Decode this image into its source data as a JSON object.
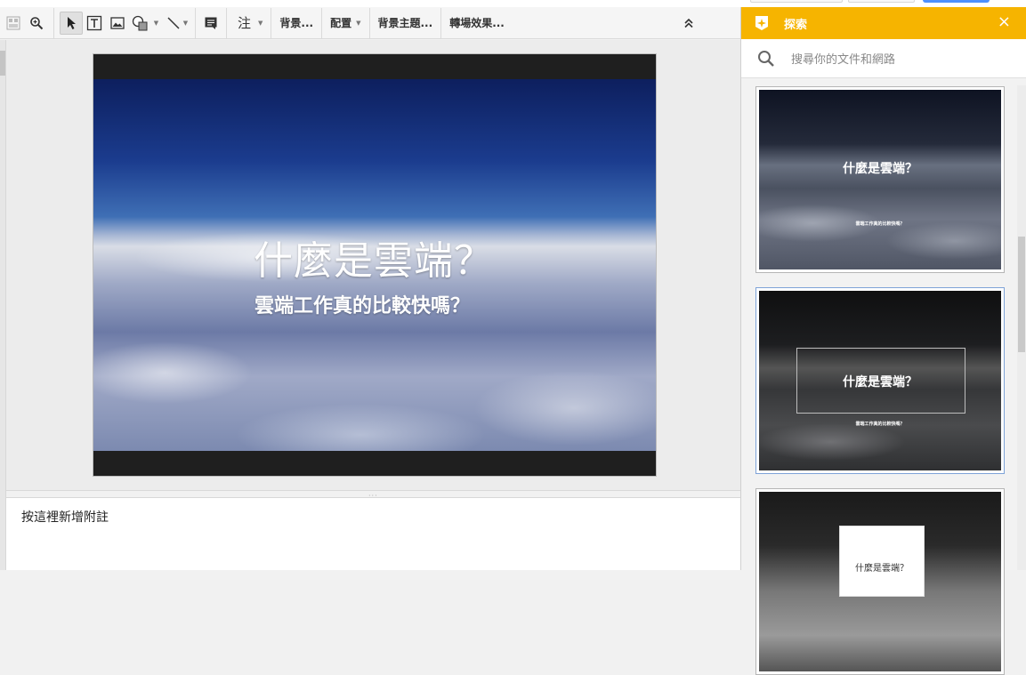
{
  "toolbar": {
    "tools": [
      {
        "name": "layout-icon"
      },
      {
        "name": "zoom-icon"
      },
      {
        "name": "select-cursor-icon"
      },
      {
        "name": "textbox-icon"
      },
      {
        "name": "image-icon"
      },
      {
        "name": "shape-icon"
      },
      {
        "name": "line-icon"
      },
      {
        "name": "comment-icon"
      }
    ],
    "comment_label": "注",
    "background_label": "背景...",
    "layout_label": "配置",
    "theme_label": "背景主題...",
    "transition_label": "轉場效果...",
    "collapse_icon": "double-chevron-up-icon"
  },
  "slide": {
    "title": "什麼是雲端？",
    "subtitle": "雲端工作真的比較快嗎？"
  },
  "notes": {
    "placeholder": "按這裡新增附註"
  },
  "explore": {
    "title": "探索",
    "close": "×",
    "search_placeholder": "搜尋你的文件和網路",
    "layouts": [
      {
        "title": "什麼是雲端？",
        "subtitle": "雲端工作真的比較快嗎？"
      },
      {
        "title": "什麼是雲端？",
        "subtitle": "雲端工作真的比較快嗎？"
      },
      {
        "title": "什麼是雲端？"
      }
    ]
  },
  "colors": {
    "explore_header": "#f6b400",
    "accent_blue": "#4d90fe"
  }
}
